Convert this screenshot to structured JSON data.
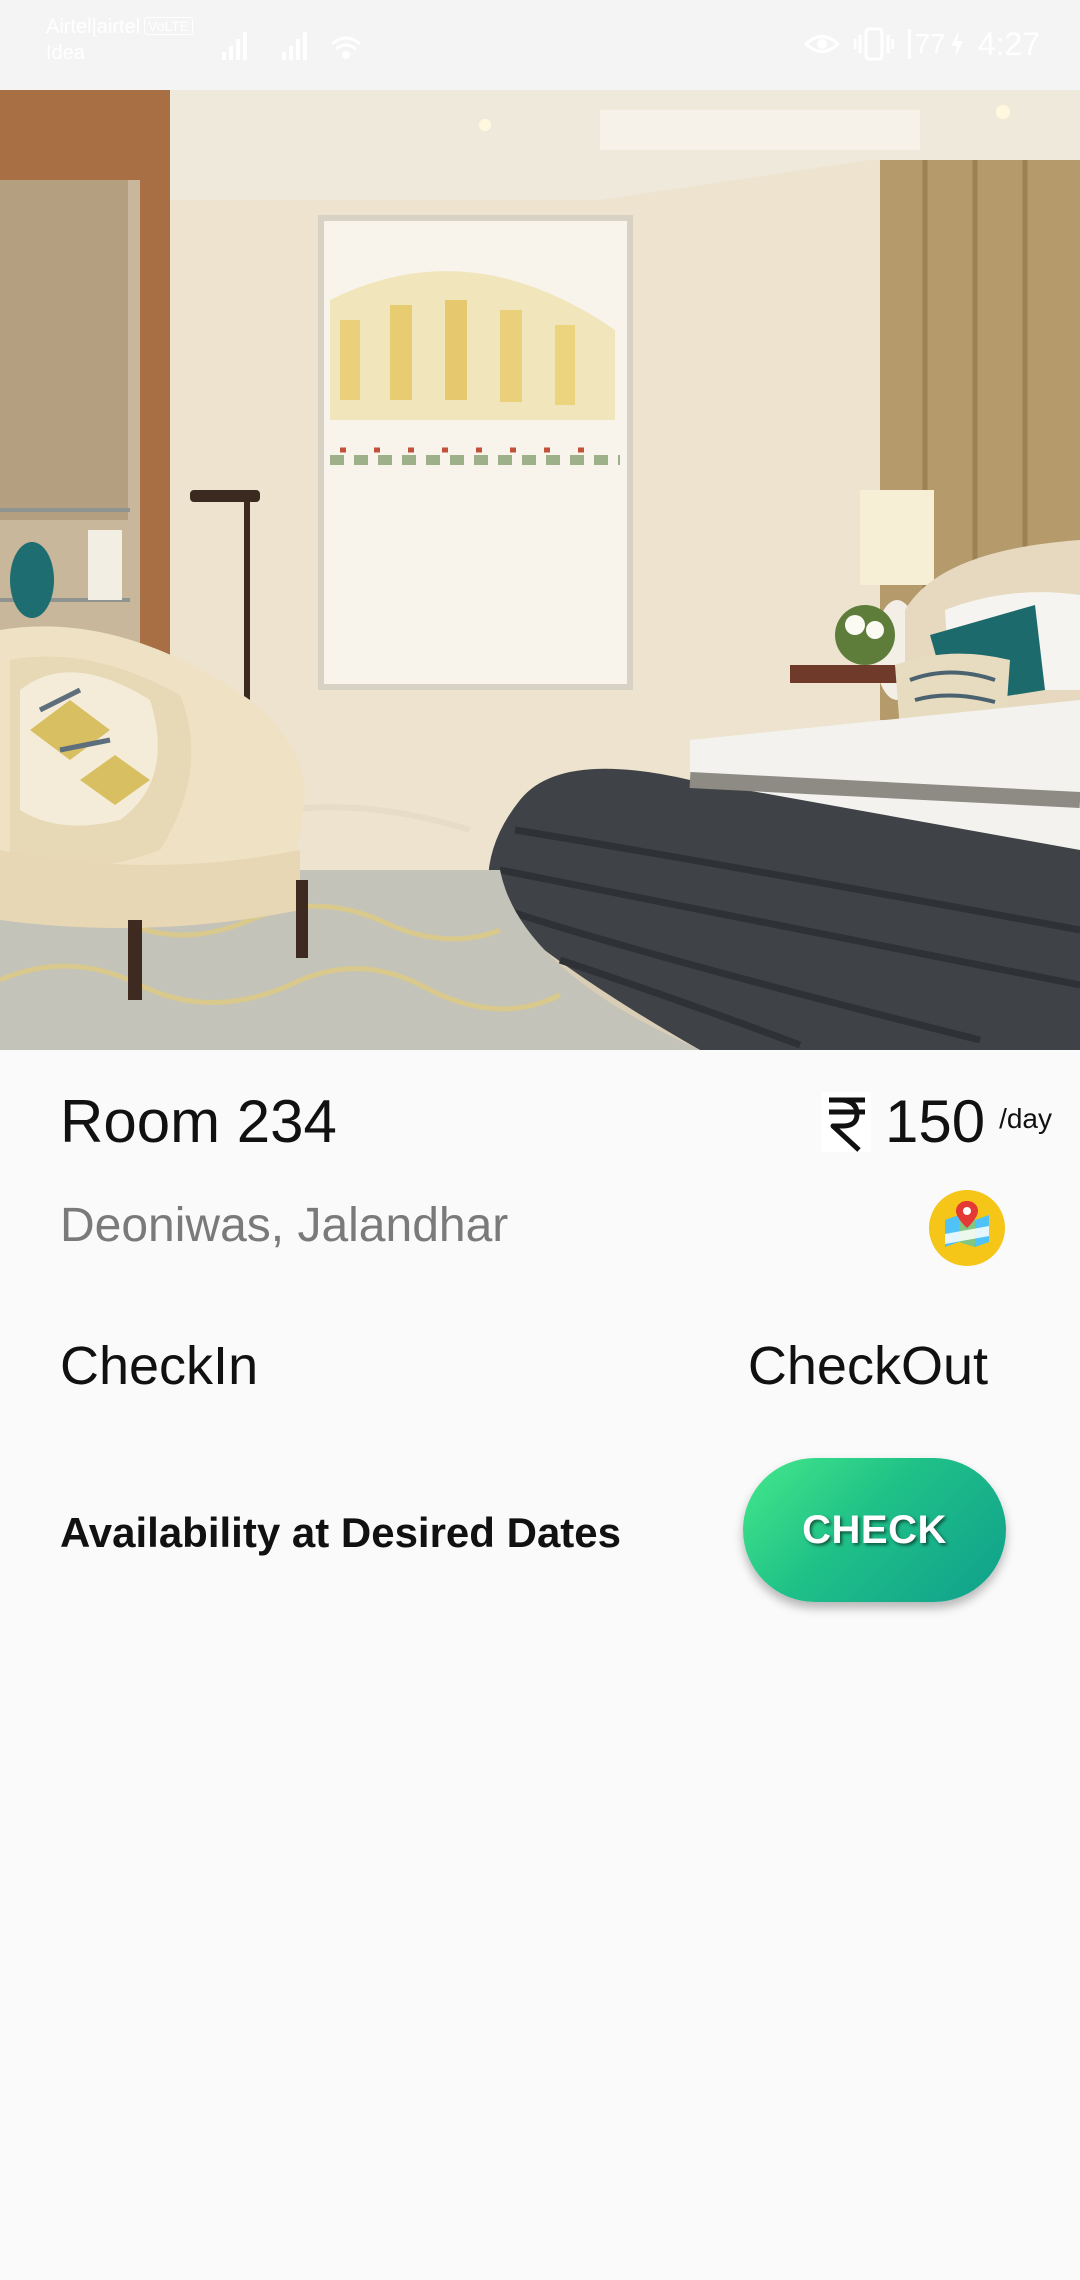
{
  "status_bar": {
    "carrier_primary": "Airtel|airtel",
    "volte_badge": "VoLTE",
    "carrier_secondary": "Idea",
    "battery": "77",
    "time": "4:27"
  },
  "room": {
    "title": "Room 234",
    "currency_icon": "rupee-icon",
    "price": "150",
    "price_unit": "/day",
    "location": "Deoniwas, Jalandhar",
    "map_icon": "maps-icon"
  },
  "dates": {
    "checkin_label": "CheckIn",
    "checkout_label": "CheckOut"
  },
  "availability": {
    "label": "Availability at Desired Dates",
    "button_label": "CHECK"
  },
  "colors": {
    "background": "#fafafa",
    "button_gradient_start": "#44e98a",
    "button_gradient_end": "#0f9f8c",
    "secondary_text": "#7a7a7a"
  }
}
